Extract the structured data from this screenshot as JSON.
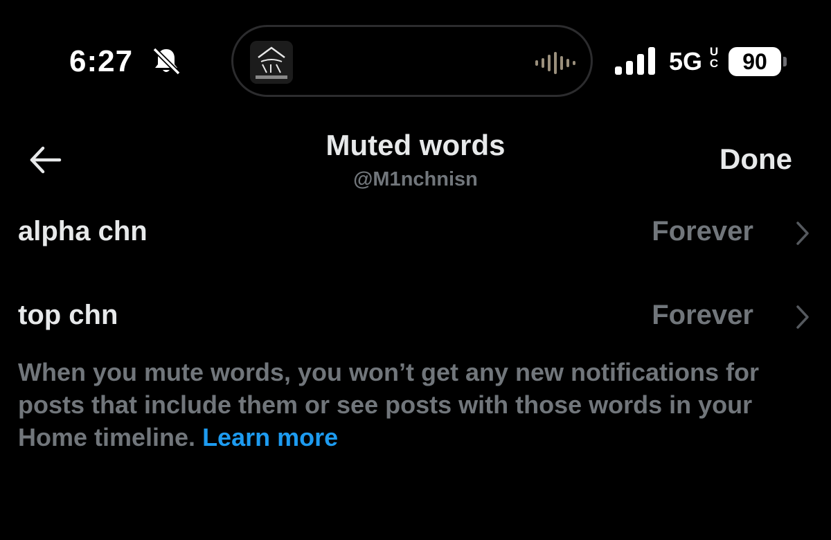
{
  "status_bar": {
    "time": "6:27",
    "network": "5G",
    "network_sup_top": "U",
    "network_sup_bottom": "C",
    "battery": "90",
    "icons": [
      "bell-slash-icon",
      "signal-icon",
      "battery-icon",
      "audio-wave-icon"
    ]
  },
  "header": {
    "title": "Muted words",
    "subtitle": "@M1nchnisn",
    "done_label": "Done",
    "back_icon": "arrow-left-icon"
  },
  "muted_words": [
    {
      "word": "alpha chn",
      "duration": "Forever"
    },
    {
      "word": "top chn",
      "duration": "Forever"
    }
  ],
  "info": {
    "text": "When you mute words, you won’t get any new notifications for posts that include them or see posts with those words in your Home timeline. ",
    "link_label": "Learn more"
  },
  "colors": {
    "background": "#000000",
    "primary_text": "#e7e9ea",
    "secondary_text": "#71767b",
    "link": "#1d9bf0"
  }
}
